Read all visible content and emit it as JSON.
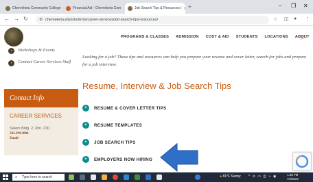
{
  "tabs": [
    {
      "label": "Chemeketa Community College",
      "color": "#7c6b45"
    },
    {
      "label": "Financial Aid - Chemeketa Com",
      "color": "#d35a24"
    },
    {
      "label": "Job Search Tips & Resources |",
      "color": "#7c6b45"
    }
  ],
  "url": "chemeketa.edu/students/career-services/job-search-tips-resources/",
  "topnav": [
    "PROGRAMS & CLASSES",
    "ADMISSION",
    "COST & AID",
    "STUDENTS",
    "LOCATIONS",
    "ABOUT"
  ],
  "sidebar": {
    "links": [
      "Workshops & Events",
      "Contact Career Services Staff"
    ],
    "contact_title": "Contact Info",
    "department": "CAREER SERVICES",
    "address": "Salem Bldg. 2, Rm. 230",
    "phone": "503.399.3006",
    "email": "Email"
  },
  "main": {
    "intro": "Looking for a job? These tips and resources can help you prepare your resume and cover letter, search for jobs and prepare for a job interview.",
    "heading": "Resume, Interview & Job Search Tips",
    "accordions": [
      "RESUME & COVER LETTER TIPS",
      "RESUME TEMPLATES",
      "JOB SEARCH TIPS",
      "EMPLOYERS NOW HIRING"
    ]
  },
  "taskbar": {
    "search_placeholder": "Type here to search",
    "weather": "81°F Sunny",
    "time": "1:35 PM",
    "date": "7/2/2024"
  },
  "colors": {
    "brand_orange": "#c75b12",
    "accordion_teal": "#0f8b8d",
    "arrow_blue": "#2f6fc8"
  }
}
